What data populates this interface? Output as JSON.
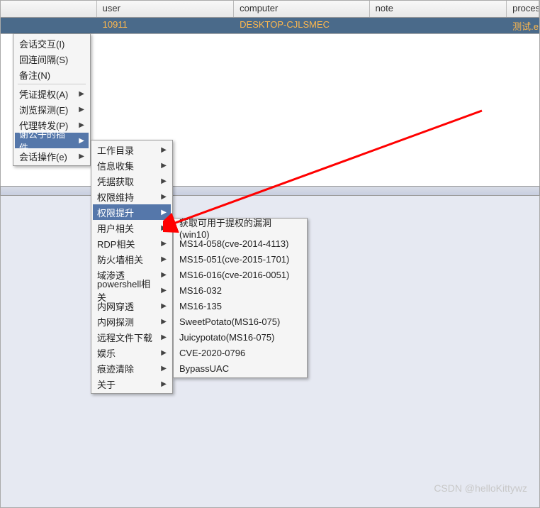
{
  "table": {
    "headers": {
      "user": "user",
      "computer": "computer",
      "note": "note",
      "process": "process"
    },
    "row": {
      "user": "10911",
      "computer": "DESKTOP-CJLSMEC",
      "note": "",
      "process": "测试.e"
    }
  },
  "menu1": {
    "items": [
      {
        "label": "会话交互(I)",
        "arrow": false
      },
      {
        "label": "回连间隔(S)",
        "arrow": false
      },
      {
        "label": "备注(N)",
        "arrow": false
      },
      {
        "label": "凭证提权(A)",
        "arrow": true
      },
      {
        "label": "浏览探测(E)",
        "arrow": true
      },
      {
        "label": "代理转发(P)",
        "arrow": true
      },
      {
        "label": "谢公子的插件",
        "arrow": true,
        "highlighted": true
      },
      {
        "label": "会话操作(e)",
        "arrow": true
      }
    ]
  },
  "menu2": {
    "items": [
      {
        "label": "工作目录",
        "arrow": true
      },
      {
        "label": "信息收集",
        "arrow": true
      },
      {
        "label": "凭据获取",
        "arrow": true
      },
      {
        "label": "权限维持",
        "arrow": true
      },
      {
        "label": "权限提升",
        "arrow": true,
        "highlighted": true
      },
      {
        "label": "用户相关",
        "arrow": true
      },
      {
        "label": "RDP相关",
        "arrow": true
      },
      {
        "label": "防火墙相关",
        "arrow": true
      },
      {
        "label": "域渗透",
        "arrow": true
      },
      {
        "label": "powershell相关",
        "arrow": true
      },
      {
        "label": "内网穿透",
        "arrow": true
      },
      {
        "label": "内网探测",
        "arrow": true
      },
      {
        "label": "远程文件下载",
        "arrow": true
      },
      {
        "label": "娱乐",
        "arrow": true
      },
      {
        "label": "痕迹清除",
        "arrow": true
      },
      {
        "label": "关于",
        "arrow": true
      }
    ]
  },
  "menu3": {
    "items": [
      {
        "label": "获取可用于提权的漏洞(win10)"
      },
      {
        "label": "MS14-058(cve-2014-4113)"
      },
      {
        "label": "MS15-051(cve-2015-1701)"
      },
      {
        "label": "MS16-016(cve-2016-0051)"
      },
      {
        "label": "MS16-032"
      },
      {
        "label": "MS16-135"
      },
      {
        "label": "SweetPotato(MS16-075)"
      },
      {
        "label": "Juicypotato(MS16-075)"
      },
      {
        "label": "CVE-2020-0796"
      },
      {
        "label": "BypassUAC"
      }
    ]
  },
  "watermark": "CSDN @helloKittywz"
}
